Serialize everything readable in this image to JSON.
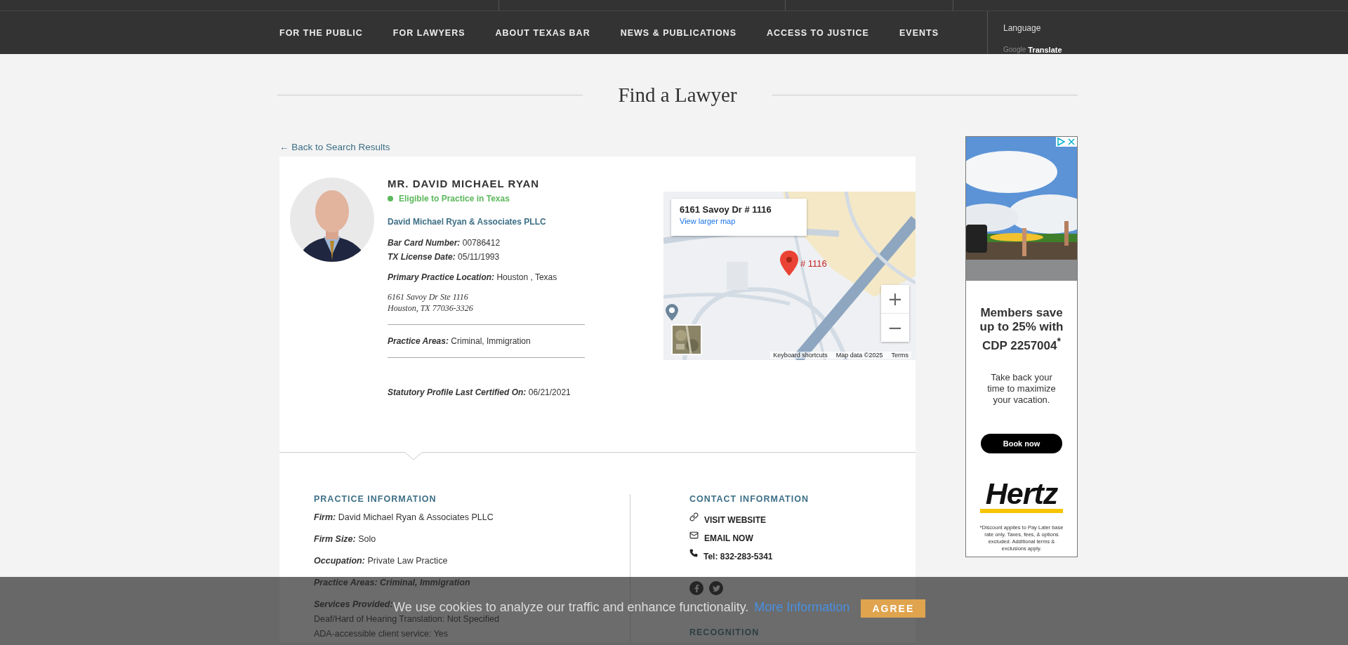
{
  "header": {
    "nav": [
      {
        "label": "FOR THE PUBLIC"
      },
      {
        "label": "FOR LAWYERS"
      },
      {
        "label": "ABOUT TEXAS BAR"
      },
      {
        "label": "NEWS & PUBLICATIONS"
      },
      {
        "label": "ACCESS TO JUSTICE"
      },
      {
        "label": "EVENTS"
      }
    ],
    "language": {
      "label": "Language",
      "brand": "Google",
      "action": "Translate"
    }
  },
  "page_title": "Find a Lawyer",
  "back_link": "← Back to Search Results",
  "profile": {
    "name": "MR. DAVID MICHAEL RYAN",
    "status": {
      "text": "Eligible to Practice in Texas",
      "eligible": true
    },
    "firm": "David Michael Ryan & Associates PLLC",
    "license_fields": [
      {
        "label": "Bar Card Number:",
        "value": "00786412"
      },
      {
        "label": "TX License Date:",
        "value": "05/11/1993"
      }
    ],
    "location": {
      "label": "Primary Practice Location:",
      "value": "Houston , Texas"
    },
    "address": [
      "6161 Savoy Dr Ste 1116",
      "Houston, TX 77036-3326"
    ],
    "practice_areas": {
      "label": "Practice Areas:",
      "value": "Criminal, Immigration"
    },
    "certified": {
      "label": "Statutory Profile Last Certified On:",
      "value": "06/21/2021"
    }
  },
  "map": {
    "place": "6161 Savoy Dr # 1116",
    "link": "View larger map",
    "marker": "# 1116",
    "zoom_in": "+",
    "zoom_out": "−",
    "footer": [
      "Keyboard shortcuts",
      "Map data ©2025",
      "Terms"
    ]
  },
  "practice_information": {
    "heading": "PRACTICE INFORMATION",
    "items": [
      {
        "label": "Firm:",
        "value": "David Michael Ryan & Associates PLLC",
        "emphasis": false
      },
      {
        "label": "Firm Size:",
        "value": "Solo",
        "emphasis": false
      },
      {
        "label": "Occupation:",
        "value": "Private Law Practice",
        "emphasis": false
      },
      {
        "label": "Practice Areas:",
        "value": "Criminal, Immigration",
        "emphasis": true
      }
    ],
    "services": {
      "label": "Services Provided:",
      "items": [
        "Deaf/Hard of Hearing Translation: Not Specified",
        "ADA-accessible client service: Yes"
      ]
    }
  },
  "contact_information": {
    "heading": "CONTACT INFORMATION",
    "links": [
      {
        "kind": "website",
        "label": "VISIT WEBSITE"
      },
      {
        "kind": "email",
        "label": "EMAIL NOW"
      },
      {
        "kind": "phone",
        "label": "Tel: 832-283-5341"
      }
    ],
    "social": [
      {
        "kind": "facebook"
      },
      {
        "kind": "twitter"
      }
    ],
    "recognition": "RECOGNITION"
  },
  "ad": {
    "headline": "Members save up to 25% with CDP 2257004$^{*}$",
    "body": "Take back your time to maximize your vacation.",
    "button": "Book now",
    "brand": "Hertz",
    "disclaimer": "*Discount applies to Pay Later base rate only. Taxes, fees, & options excluded. Additional terms & exclusions apply."
  },
  "cookie_bar": {
    "text": "We use cookies to analyze our traffic and enhance functionality.",
    "link": "More Information",
    "button": "AGREE"
  }
}
